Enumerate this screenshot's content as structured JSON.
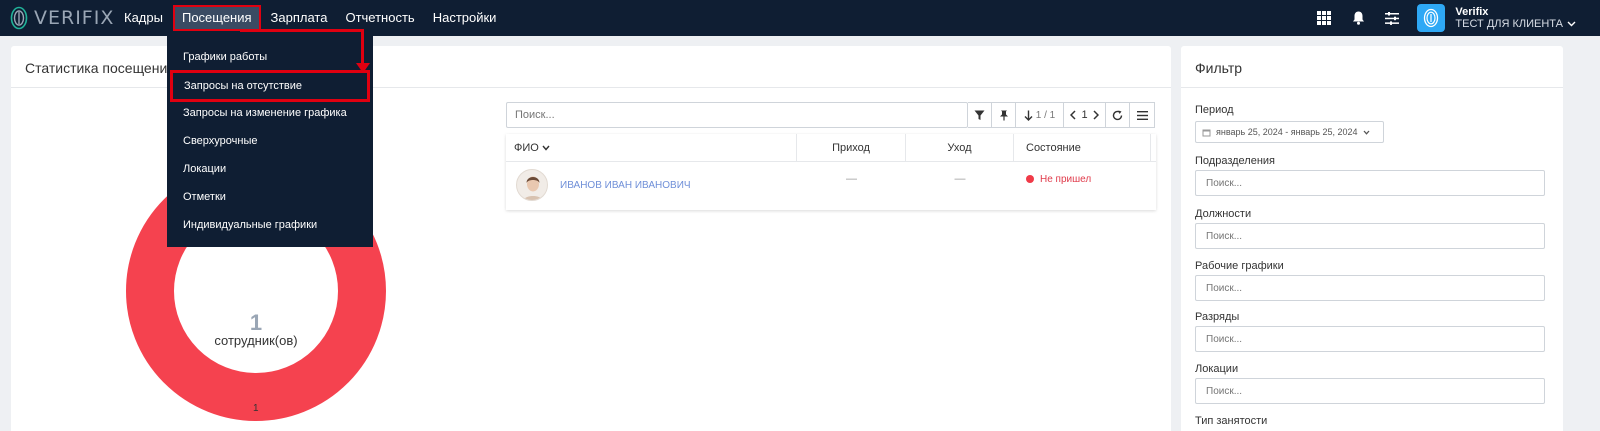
{
  "brand": {
    "name": "VERIFIX"
  },
  "nav": {
    "items": [
      "Кадры",
      "Посещения",
      "Зарплата",
      "Отчетность",
      "Настройки"
    ],
    "active": "Посещения"
  },
  "user": {
    "name": "Verifix",
    "company": "ТЕСТ ДЛЯ КЛИЕНТА"
  },
  "dropdown": {
    "items": [
      "Графики работы",
      "Запросы на отсутствие",
      "Запросы на изменение графика",
      "Сверхурочные",
      "Локации",
      "Отметки",
      "Индивидуальные графики"
    ],
    "highlighted": "Запросы на отсутствие"
  },
  "main": {
    "title": "Статистика посещений",
    "donut": {
      "count": "1",
      "label": "сотрудник(ов)",
      "bottom_value": "1",
      "color": "#f5424f"
    }
  },
  "list": {
    "search_placeholder": "Поиск...",
    "pager": "1 / 1",
    "page": "1",
    "columns": [
      "ФИО",
      "Приход",
      "Уход",
      "Состояние"
    ],
    "rows": [
      {
        "name": "ИВАНОВ ИВАН ИВАНОВИЧ",
        "in": "—",
        "out": "—",
        "status": "Не пришел"
      }
    ]
  },
  "filter": {
    "title": "Фильтр",
    "period_label": "Период",
    "period_value": "январь 25, 2024 - январь 25, 2024",
    "fields": [
      {
        "label": "Подразделения",
        "placeholder": "Поиск..."
      },
      {
        "label": "Должности",
        "placeholder": "Поиск..."
      },
      {
        "label": "Рабочие графики",
        "placeholder": "Поиск..."
      },
      {
        "label": "Разряды",
        "placeholder": "Поиск..."
      },
      {
        "label": "Локации",
        "placeholder": "Поиск..."
      },
      {
        "label": "Тип занятости"
      }
    ]
  },
  "colors": {
    "nav_bg": "#0f1e33",
    "accent_red": "#e00010",
    "avatar_blue": "#2ea8f5"
  }
}
